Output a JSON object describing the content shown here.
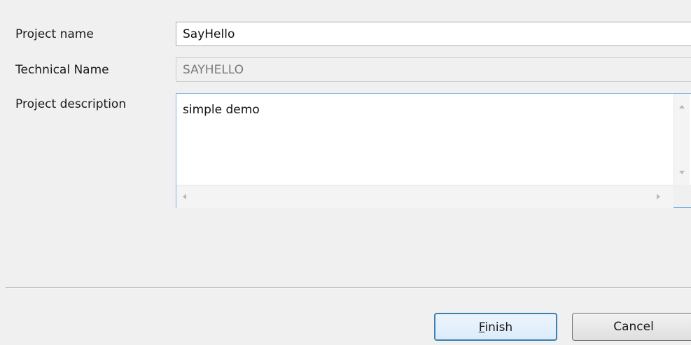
{
  "form": {
    "project_name": {
      "label": "Project name",
      "value": "SayHello"
    },
    "technical_name": {
      "label": "Technical Name",
      "value": "SAYHELLO"
    },
    "project_description": {
      "label": "Project description",
      "value": "simple demo"
    }
  },
  "buttons": {
    "finish": {
      "mnemonic": "F",
      "rest": "inish"
    },
    "cancel": {
      "label": "Cancel"
    }
  },
  "colors": {
    "background": "#f0f0f0",
    "focus_border": "#7eb4ea",
    "default_button_border": "#3c7fb1"
  }
}
